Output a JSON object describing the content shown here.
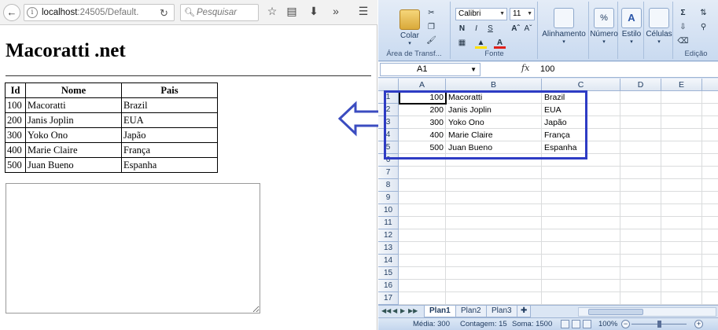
{
  "browser": {
    "url_host": "localhost",
    "url_rest": ":24505/Default.",
    "search_placeholder": "Pesquisar",
    "page_title": "Macoratti .net",
    "table": {
      "headers": [
        "Id",
        "Nome",
        "Pais"
      ],
      "rows": [
        [
          "100",
          "Macoratti",
          "Brazil"
        ],
        [
          "200",
          "Janis Joplin",
          "EUA"
        ],
        [
          "300",
          "Yoko Ono",
          "Japão"
        ],
        [
          "400",
          "Marie Claire",
          "França"
        ],
        [
          "500",
          "Juan Bueno",
          "Espanha"
        ]
      ]
    },
    "textarea_value": ""
  },
  "excel": {
    "ribbon": {
      "paste_label": "Colar",
      "clipboard_label": "Área de Transf...",
      "font_name": "Calibri",
      "font_size": "11",
      "font_group_label": "Fonte",
      "bold": "N",
      "italic": "I",
      "underline": "S",
      "alignment_label": "Alinhamento",
      "number_label": "Número",
      "style_label": "Estilo",
      "cells_label": "Células",
      "editing_label": "Edição"
    },
    "name_box": "A1",
    "formula_value": "100",
    "columns": [
      "A",
      "B",
      "C",
      "D",
      "E"
    ],
    "row_numbers": [
      "1",
      "2",
      "3",
      "4",
      "5",
      "6",
      "7",
      "8",
      "9",
      "10",
      "11",
      "12",
      "13",
      "14",
      "15",
      "16",
      "17"
    ],
    "cells": [
      [
        "100",
        "Macoratti",
        "Brazil"
      ],
      [
        "200",
        "Janis Joplin",
        "EUA"
      ],
      [
        "300",
        "Yoko Ono",
        "Japão"
      ],
      [
        "400",
        "Marie Claire",
        "França"
      ],
      [
        "500",
        "Juan Bueno",
        "Espanha"
      ]
    ],
    "sheets": [
      "Plan1",
      "Plan2",
      "Plan3"
    ],
    "status": {
      "average": "Média: 300",
      "count": "Contagem: 15",
      "sum": "Soma: 1500",
      "zoom": "100%"
    }
  },
  "colors": {
    "arrow": "#3b4cc0",
    "highlight": "#2e3cc4"
  }
}
